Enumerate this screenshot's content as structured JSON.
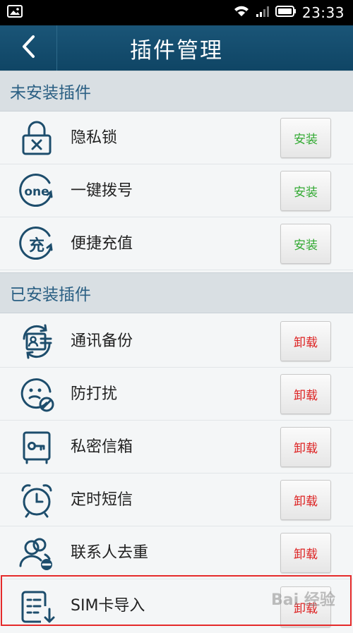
{
  "status_bar": {
    "time": "23:33"
  },
  "title_bar": {
    "title": "插件管理"
  },
  "sections": {
    "not_installed": {
      "header": "未安装插件",
      "items": [
        {
          "label": "隐私锁",
          "button": "安装",
          "icon": "padlock-icon"
        },
        {
          "label": "一键拨号",
          "button": "安装",
          "icon": "one-dial-icon"
        },
        {
          "label": "便捷充值",
          "button": "安装",
          "icon": "recharge-icon"
        }
      ]
    },
    "installed": {
      "header": "已安装插件",
      "items": [
        {
          "label": "通讯备份",
          "button": "卸载",
          "icon": "contact-backup-icon"
        },
        {
          "label": "防打扰",
          "button": "卸载",
          "icon": "do-not-disturb-icon"
        },
        {
          "label": "私密信箱",
          "button": "卸载",
          "icon": "private-mailbox-icon"
        },
        {
          "label": "定时短信",
          "button": "卸载",
          "icon": "alarm-clock-icon"
        },
        {
          "label": "联系人去重",
          "button": "卸载",
          "icon": "contacts-dedupe-icon"
        },
        {
          "label": "SIM卡导入",
          "button": "卸载",
          "icon": "sim-import-icon"
        }
      ]
    }
  },
  "watermark": "Bai 经验",
  "colors": {
    "title_bar": "#15506f",
    "section_text": "#2a5f83",
    "icon": "#1d4d6c",
    "install": "#33aa33",
    "uninstall": "#dd2222",
    "highlight": "#e52a2a"
  }
}
